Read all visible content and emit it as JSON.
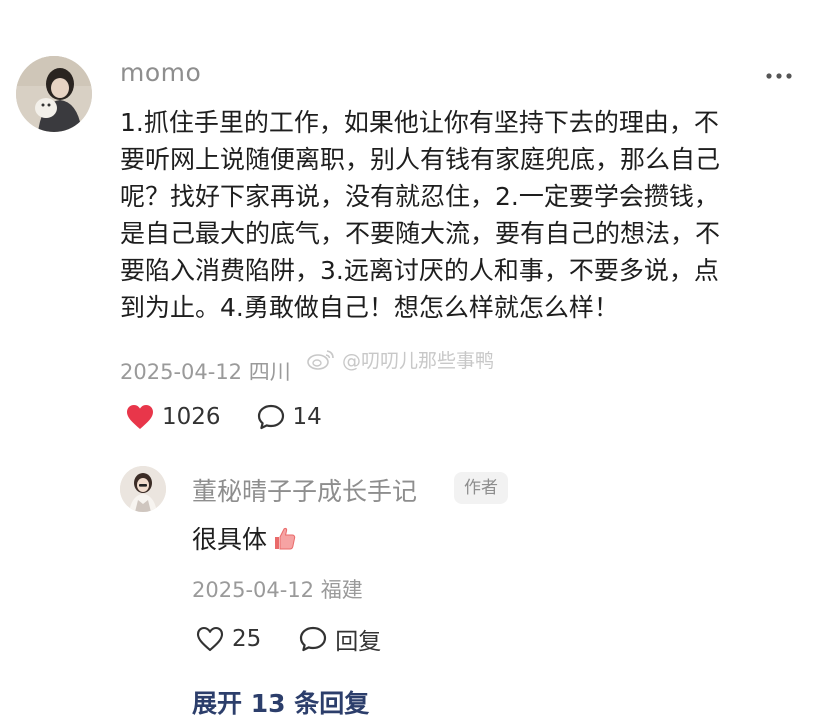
{
  "comment": {
    "username": "momo",
    "content": "1.抓住手里的工作，如果他让你有坚持下去的理由，不\n要听网上说随便离职，别人有钱有家庭兜底，那么自己\n呢？找好下家再说，没有就忍住，2.一定要学会攒钱，\n是自己最大的底气，不要随大流，要有自己的想法，不\n要陷入消费陷阱，3.远离讨厌的人和事，不要多说，点\n到为止。4.勇敢做自己！想怎么样就怎么样！",
    "date_location": "2025-04-12 四川",
    "likes": "1026",
    "comments": "14"
  },
  "watermark": {
    "text": "@叨叨儿那些事鸭"
  },
  "reply": {
    "username": "董秘晴子子成长手记",
    "author_tag": "作者",
    "text": "很具体",
    "date_location": "2025-04-12 福建",
    "likes": "25",
    "reply_label": "回复"
  },
  "expand_label": "展开 13 条回复",
  "colors": {
    "heart_liked": "#e8364a",
    "expand_link": "#2c3e6b",
    "meta_gray": "#9a9a9a"
  },
  "icons": [
    "more-icon",
    "heart-filled-icon",
    "comment-icon",
    "heart-outline-icon",
    "thumbs-up-emoji",
    "weibo-logo"
  ]
}
